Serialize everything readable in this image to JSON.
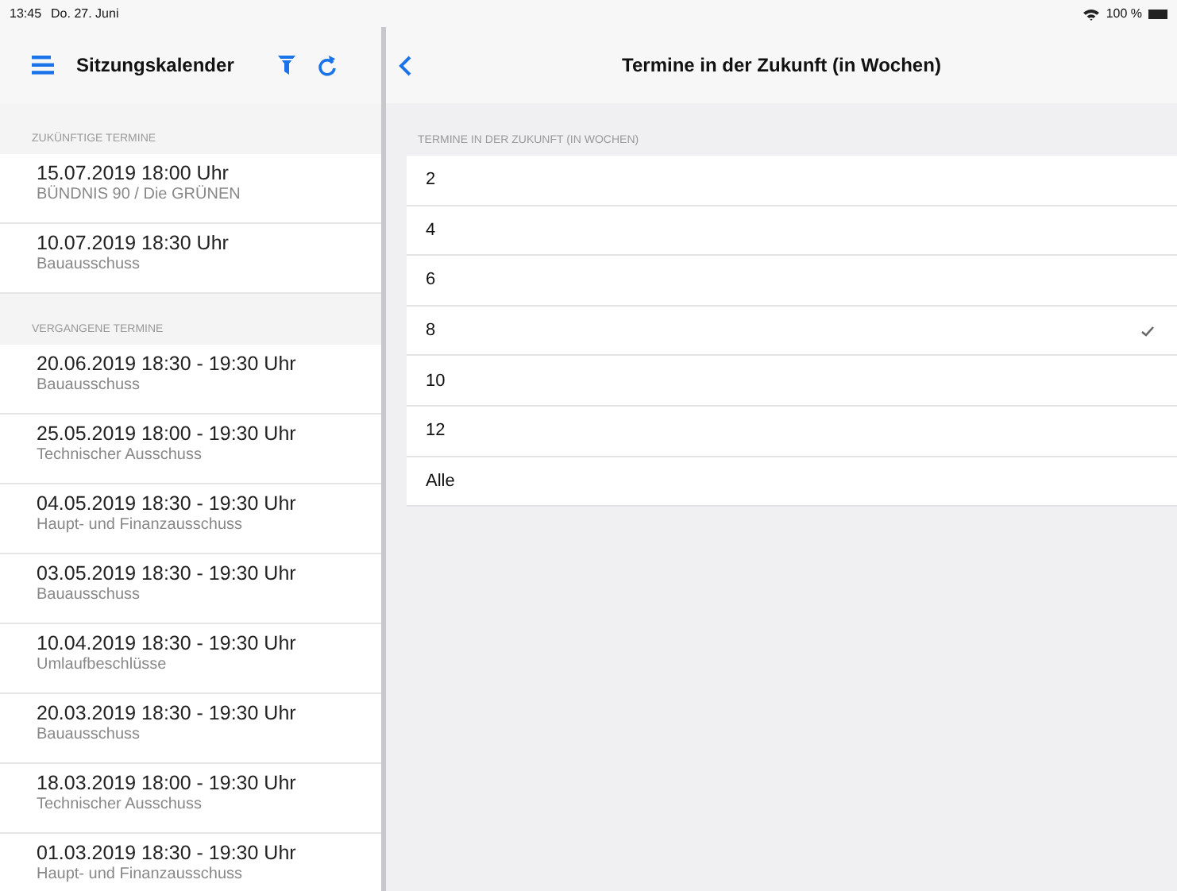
{
  "status_bar": {
    "time": "13:45",
    "date": "Do. 27. Juni",
    "battery": "100 %"
  },
  "sidebar": {
    "title": "Sitzungskalender",
    "sections": [
      {
        "header": "ZUKÜNFTIGE TERMINE",
        "items": [
          {
            "date": "15.07.2019 18:00 Uhr",
            "committee": "BÜNDNIS 90 / Die GRÜNEN"
          },
          {
            "date": "10.07.2019 18:30 Uhr",
            "committee": "Bauausschuss"
          }
        ]
      },
      {
        "header": "VERGANGENE TERMINE",
        "items": [
          {
            "date": "20.06.2019 18:30 -  19:30 Uhr",
            "committee": "Bauausschuss"
          },
          {
            "date": "25.05.2019 18:00 -  19:30 Uhr",
            "committee": "Technischer Ausschuss"
          },
          {
            "date": "04.05.2019 18:30 -  19:30 Uhr",
            "committee": "Haupt- und Finanzausschuss"
          },
          {
            "date": "03.05.2019 18:30 -  19:30 Uhr",
            "committee": "Bauausschuss"
          },
          {
            "date": "10.04.2019 18:30 -  19:30 Uhr",
            "committee": "Umlaufbeschlüsse"
          },
          {
            "date": "20.03.2019 18:30 -  19:30 Uhr",
            "committee": "Bauausschuss"
          },
          {
            "date": "18.03.2019 18:00 -  19:30 Uhr",
            "committee": "Technischer Ausschuss"
          },
          {
            "date": "01.03.2019 18:30 -  19:30 Uhr",
            "committee": "Haupt- und Finanzausschuss"
          }
        ]
      }
    ]
  },
  "detail": {
    "title": "Termine in der Zukunft (in Wochen)",
    "section_header": "TERMINE IN DER ZUKUNFT (IN WOCHEN)",
    "options": [
      {
        "label": "2",
        "selected": false
      },
      {
        "label": "4",
        "selected": false
      },
      {
        "label": "6",
        "selected": false
      },
      {
        "label": "8",
        "selected": true
      },
      {
        "label": "10",
        "selected": false
      },
      {
        "label": "12",
        "selected": false
      },
      {
        "label": "Alle",
        "selected": false
      }
    ]
  }
}
